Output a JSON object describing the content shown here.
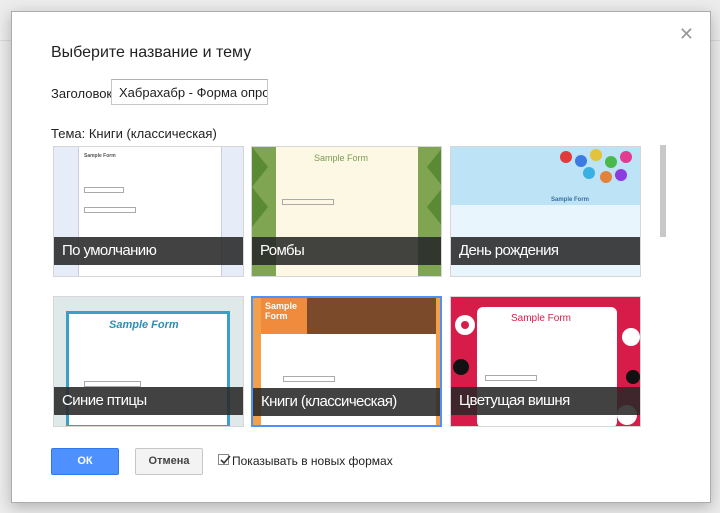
{
  "dialog": {
    "title": "Выберите название и тему",
    "header_label": "Заголовок",
    "header_value": "Хабрахабр - Форма опро",
    "theme_label": "Тема: Книги (классическая)",
    "close_icon": "close-icon"
  },
  "themes": [
    {
      "label": "По умолчанию",
      "preview": "Sample Form"
    },
    {
      "label": "Ромбы",
      "preview": "Sample Form"
    },
    {
      "label": "День рождения",
      "preview": "Sample Form"
    },
    {
      "label": "Синие птицы",
      "preview": "Sample Form"
    },
    {
      "label": "Книги (классическая)",
      "preview": "Sample Form",
      "selected": true
    },
    {
      "label": "Цветущая вишня",
      "preview": "Sample Form"
    }
  ],
  "buttons": {
    "ok": "ОК",
    "cancel": "Отмена"
  },
  "show_in_new": {
    "label": "Показывать в новых формах",
    "checked": true
  },
  "colors": {
    "accent": "#4d90fe",
    "caption_bg": "#282828"
  }
}
